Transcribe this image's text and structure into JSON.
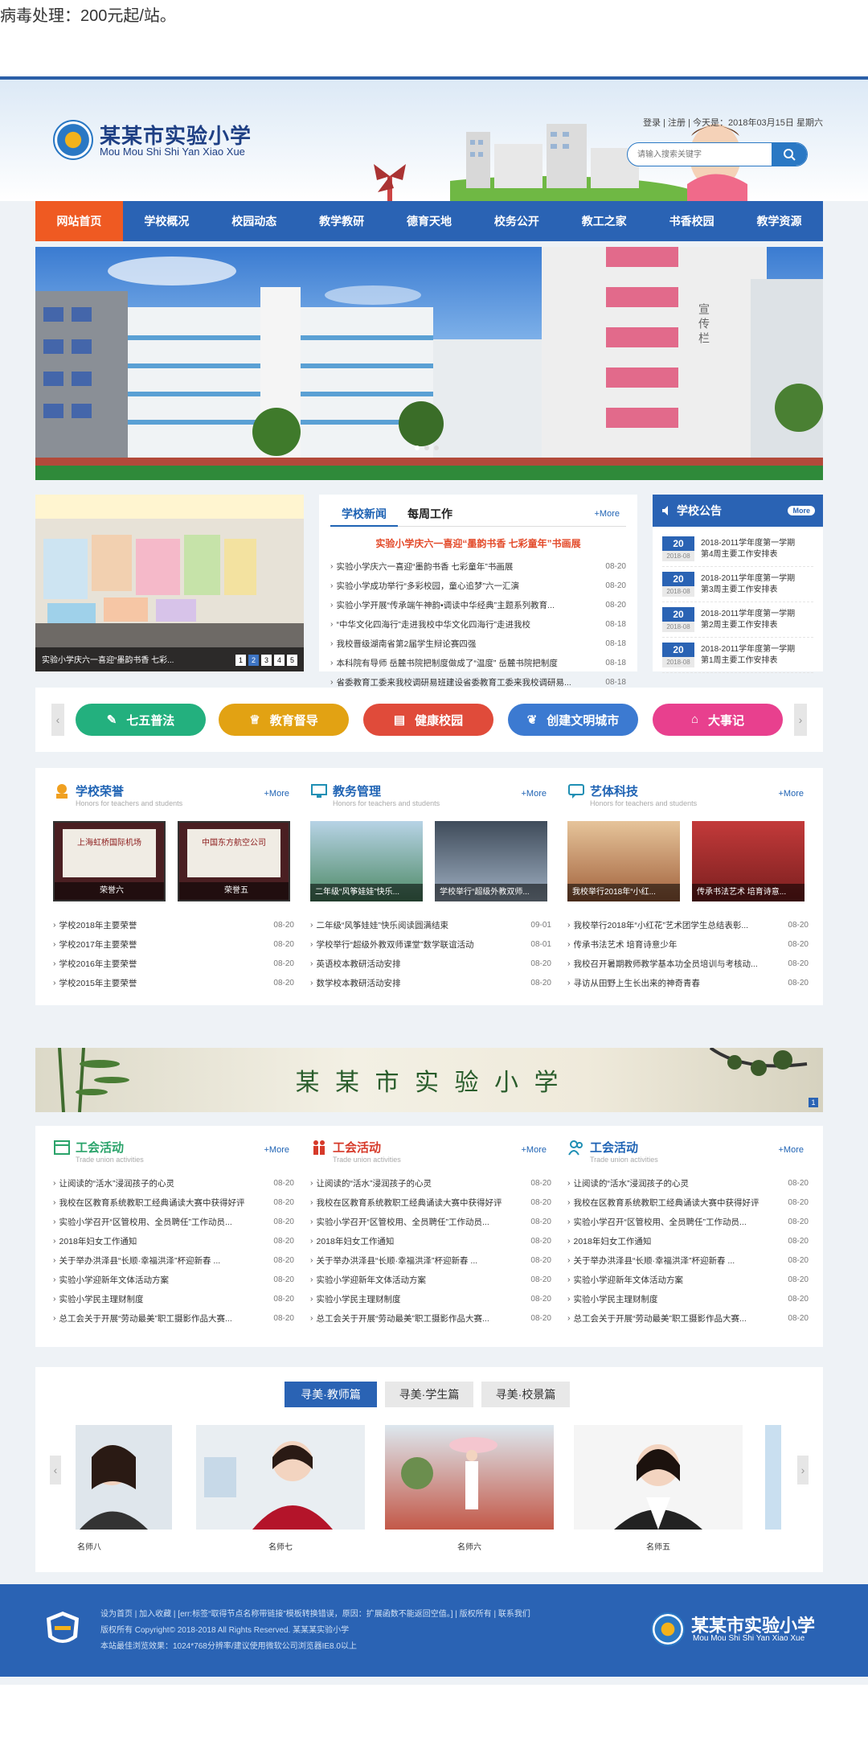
{
  "top_note": "病毒处理：200元起/站。",
  "header": {
    "logo_cn": "某某市实验小学",
    "logo_en": "Mou Mou Shi Shi Yan Xiao Xue",
    "login": "登录",
    "register": "注册",
    "today": "今天是：2018年03月15日 星期六",
    "search_placeholder": "请输入搜索关键字"
  },
  "nav": [
    "网站首页",
    "学校概况",
    "校园动态",
    "教学教研",
    "德育天地",
    "校务公开",
    "教工之家",
    "书香校园",
    "教学资源"
  ],
  "banner": {
    "building_sign": "宣传栏"
  },
  "slider": {
    "caption": "实验小学庆六一喜迎“墨韵书香 七彩...",
    "pages": [
      "1",
      "2",
      "3",
      "4",
      "5"
    ]
  },
  "news": {
    "tab_active": "学校新闻",
    "tab_other": "每周工作",
    "more": "+More",
    "headline": "实验小学庆六一喜迎“墨韵书香 七彩童年”书画展",
    "items": [
      {
        "t": "实验小学庆六一喜迎“墨韵书香 七彩童年”书画展",
        "d": "08-20"
      },
      {
        "t": "实验小学成功举行“多彩校园，童心追梦”六一汇演",
        "d": "08-20"
      },
      {
        "t": "实验小学开展“传承端午神韵•调读中华经典”主题系列教育...",
        "d": "08-20"
      },
      {
        "t": "“中华文化四海行”走进我校中华文化四海行”走进我校",
        "d": "08-18"
      },
      {
        "t": "我校晋级湖南省第2届学生辩论赛四强",
        "d": "08-18"
      },
      {
        "t": "本科院有导师 岳麓书院把制度做成了“温度” 岳麓书院把制度",
        "d": "08-18"
      },
      {
        "t": "省委教育工委来我校调研易班建设省委教育工委来我校调研易...",
        "d": "08-18"
      }
    ]
  },
  "notice": {
    "title": "学校公告",
    "more": "More",
    "items": [
      {
        "day": "20",
        "ym": "2018-08",
        "l1": "2018-2011学年度第一学期",
        "l2": "第4周主要工作安排表"
      },
      {
        "day": "20",
        "ym": "2018-08",
        "l1": "2018-2011学年度第一学期",
        "l2": "第3周主要工作安排表"
      },
      {
        "day": "20",
        "ym": "2018-08",
        "l1": "2018-2011学年度第一学期",
        "l2": "第2周主要工作安排表"
      },
      {
        "day": "20",
        "ym": "2018-08",
        "l1": "2018-2011学年度第一学期",
        "l2": "第1周主要工作安排表"
      }
    ]
  },
  "quick_links": [
    "七五普法",
    "教育督导",
    "健康校园",
    "创建文明城市",
    "大事记"
  ],
  "honors": {
    "title": "学校荣誉",
    "sub": "Honors for teachers and students",
    "more": "+More",
    "photos": [
      "荣誉六",
      "荣誉五"
    ],
    "plaque1": "上海虹桥国际机场",
    "plaque2": "中国东方航空公司",
    "items": [
      {
        "t": "学校2018年主要荣誉",
        "d": "08-20"
      },
      {
        "t": "学校2017年主要荣誉",
        "d": "08-20"
      },
      {
        "t": "学校2016年主要荣誉",
        "d": "08-20"
      },
      {
        "t": "学校2015年主要荣誉",
        "d": "08-20"
      }
    ]
  },
  "teaching": {
    "title": "教务管理",
    "sub": "Honors for teachers and students",
    "more": "+More",
    "photos": [
      "二年级“风筝娃娃”快乐...",
      "学校举行“超级外教双师..."
    ],
    "items": [
      {
        "t": "二年级“风筝娃娃”快乐阅读圆满结束",
        "d": "09-01"
      },
      {
        "t": "学校举行“超级外教双师课堂”数学联谊活动",
        "d": "08-01"
      },
      {
        "t": "英语校本教研活动安排",
        "d": "08-20"
      },
      {
        "t": "数学校本教研活动安排",
        "d": "08-20"
      }
    ]
  },
  "arts": {
    "title": "艺体科技",
    "sub": "Honors for teachers and students",
    "more": "+More",
    "photos": [
      "我校举行2018年“小红...",
      "传承书法艺术 培育诗意..."
    ],
    "items": [
      {
        "t": "我校举行2018年“小红花”艺术团学生总结表彰...",
        "d": "08-20"
      },
      {
        "t": "传承书法艺术 培育诗意少年",
        "d": "08-20"
      },
      {
        "t": "我校召开暑期教师教学基本功全员培训与考核动...",
        "d": "08-20"
      },
      {
        "t": "寻访从田野上生长出来的神奇青春",
        "d": "08-20"
      }
    ]
  },
  "school_banner": {
    "text": "某 某 市 实 验 小 学",
    "badge": "1"
  },
  "union": [
    {
      "title": "工会活动",
      "sub": "Trade union activities",
      "more": "+More"
    },
    {
      "title": "工会活动",
      "sub": "Trade union activities",
      "more": "+More"
    },
    {
      "title": "工会活动",
      "sub": "Trade union activities",
      "more": "+More"
    }
  ],
  "union_items": [
    {
      "t": "让阅读的“活水”浸润孩子的心灵",
      "d": "08-20"
    },
    {
      "t": "我校在区教育系统教职工经典诵读大赛中获得好评",
      "d": "08-20"
    },
    {
      "t": "实验小学召开“区管校用、全员聘任”工作动员...",
      "d": "08-20"
    },
    {
      "t": "2018年妇女工作通知",
      "d": "08-20"
    },
    {
      "t": "关于举办洪泽县“长顺·幸福洪泽”杯迎新春 ...",
      "d": "08-20"
    },
    {
      "t": "实验小学迎新年文体活动方案",
      "d": "08-20"
    },
    {
      "t": "实验小学民主理财制度",
      "d": "08-20"
    },
    {
      "t": "总工会关于开展“劳动最美”职工摄影作品大赛...",
      "d": "08-20"
    }
  ],
  "showcase": {
    "tabs": [
      "寻美·教师篇",
      "寻美·学生篇",
      "寻美·校景篇"
    ],
    "names": [
      "名师八",
      "名师七",
      "名师六",
      "名师五"
    ]
  },
  "footer": {
    "links": "设为首页 | 加入收藏 | [err:标签“取得节点名称带链接”模板转换错误，原因：扩展函数不能返回空值。] | 版权所有 | 联系我们",
    "copyright": "版权所有 Copyright© 2018-2018 All Rights Reserved. 某某某实验小学",
    "tip": "本站最佳浏览效果：1024*768分辨率/建议使用微软公司浏览器IE8.0以上",
    "logo_cn": "某某市实验小学",
    "logo_en": "Mou Mou Shi Shi Yan Xiao Xue"
  }
}
